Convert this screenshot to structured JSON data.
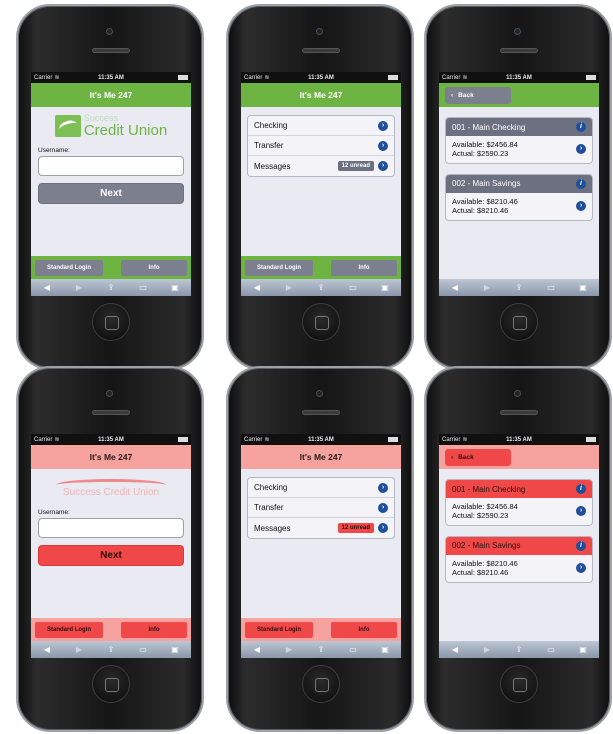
{
  "status": {
    "carrier": "Carrier",
    "time": "11:35 AM"
  },
  "app_title": "It's Me 247",
  "login": {
    "logo_green_line1": "Success",
    "logo_green_line2": "Credit Union",
    "logo_red": "Success Credit Union",
    "username_label": "Username:",
    "username_value": "",
    "next_label": "Next",
    "standard_login_label": "Standard Login",
    "info_label": "Info"
  },
  "menu": {
    "items": [
      {
        "label": "Checking"
      },
      {
        "label": "Transfer"
      },
      {
        "label": "Messages",
        "badge": "12 unread"
      }
    ]
  },
  "accounts": {
    "back_label": "Back",
    "list": [
      {
        "title": "001 - Main Checking",
        "available": "Available:  $2456.84",
        "actual": "Actual:  $2590.23"
      },
      {
        "title": "002 - Main Savings",
        "available": "Available:  $8210.46",
        "actual": "Actual:  $8210.46"
      }
    ]
  },
  "themes": {
    "green": "#6eb443",
    "red": "#f04848",
    "red_light": "#f6a3a0",
    "gray": "#7c7f8e",
    "chevron": "#1f4f9b"
  },
  "icons": {
    "back_arrow": "back-arrow-icon",
    "forward_arrow": "forward-arrow-icon",
    "share": "share-icon",
    "bookmarks": "bookmarks-icon",
    "tabs": "tabs-icon",
    "chevron": "chevron-right-icon",
    "info": "info-icon"
  }
}
